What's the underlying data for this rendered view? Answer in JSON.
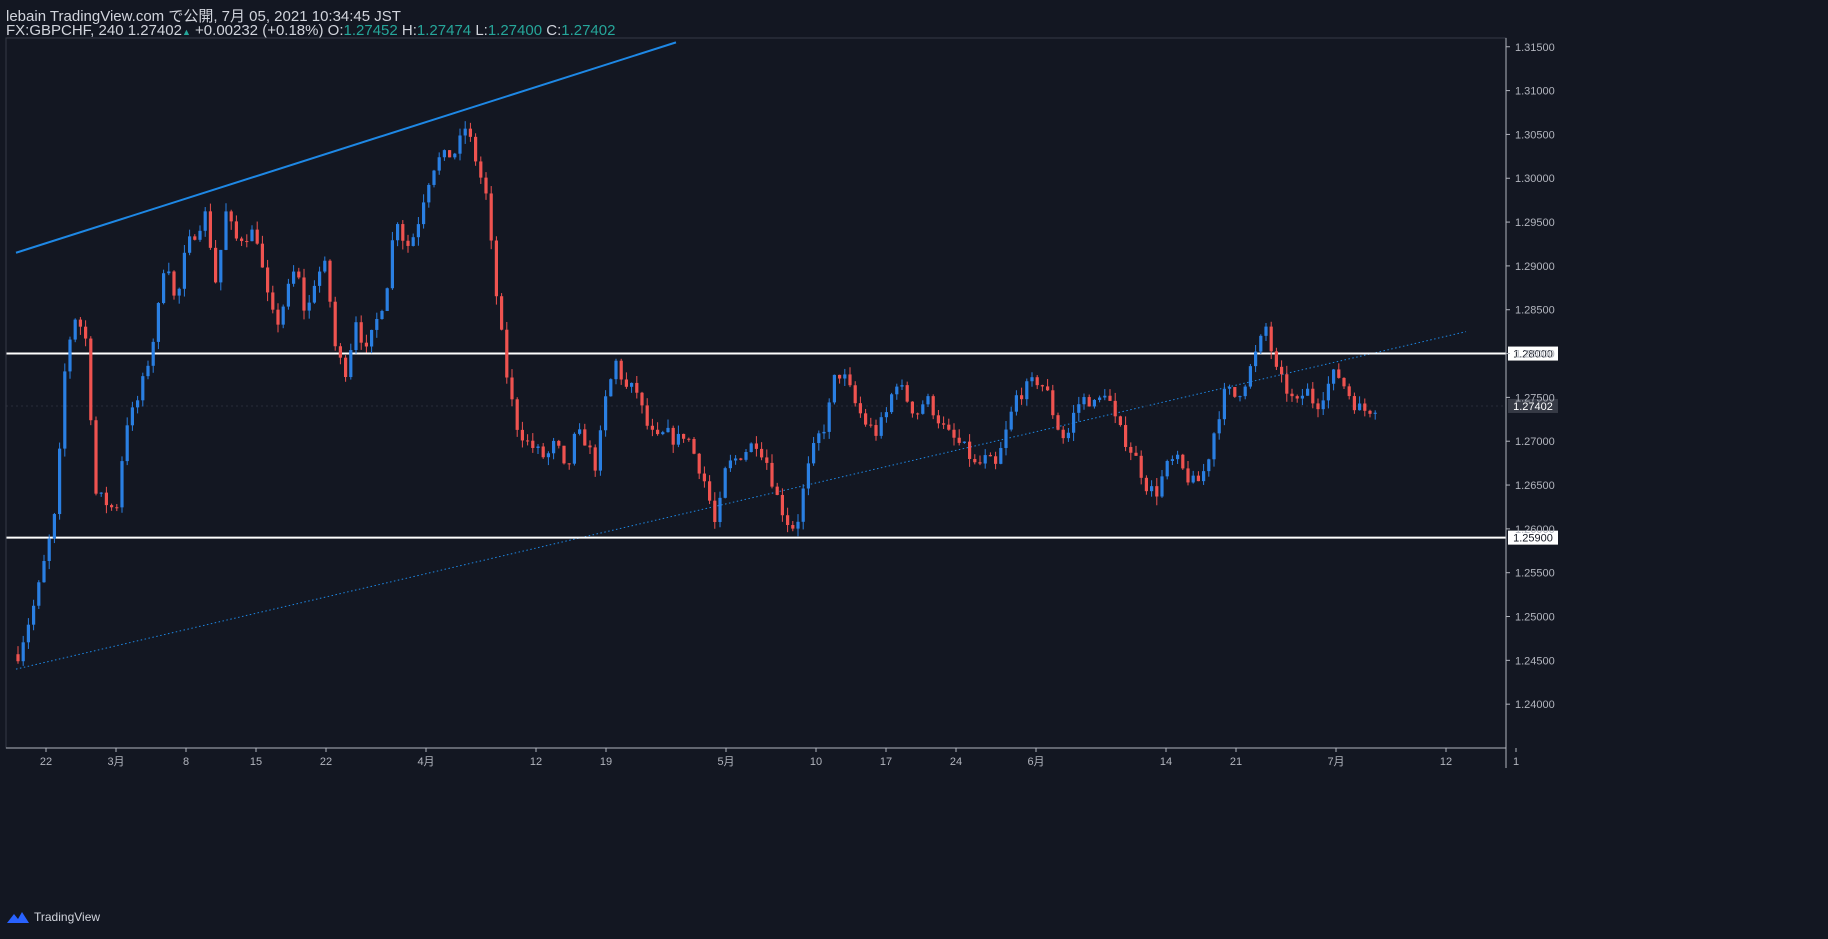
{
  "header": {
    "publisher": "lebain TradingView.com で公開, 7月 05, 2021 10:34:45 JST",
    "symbol": "FX:GBPCHF, 240",
    "last": "1.27402",
    "arrow": "▲",
    "change": "+0.00232 (+0.18%)",
    "o_label": "O:",
    "o": "1.27452",
    "h_label": "H:",
    "h": "1.27474",
    "l_label": "L:",
    "l": "1.27400",
    "c_label": "C:",
    "c": "1.27402"
  },
  "footer": {
    "brand": "TradingView"
  },
  "colors": {
    "background": "#131722",
    "up": "#2a7fe2",
    "down": "#ef5350",
    "trend": "#1e88e5",
    "level": "#ffffff",
    "axis": "#b2b5be"
  },
  "chart_data": {
    "type": "candlestick",
    "symbol": "GBPCHF",
    "timeframe": "240",
    "ylim": [
      1.235,
      1.316
    ],
    "y_ticks": [
      "1.24000",
      "1.24500",
      "1.25000",
      "1.25500",
      "1.26000",
      "1.26500",
      "1.27000",
      "1.27500",
      "1.28000",
      "1.28500",
      "1.29000",
      "1.29500",
      "1.30000",
      "1.30500",
      "1.31000",
      "1.31500"
    ],
    "x_ticks": [
      "22",
      "3月",
      "8",
      "15",
      "22",
      "4月",
      "12",
      "19",
      "5月",
      "10",
      "17",
      "24",
      "6月",
      "14",
      "21",
      "7月",
      "12",
      "1"
    ],
    "horizontal_levels": [
      {
        "value": 1.28,
        "label": "1.28000"
      },
      {
        "value": 1.259,
        "label": "1.25900"
      }
    ],
    "last_price": {
      "value": 1.27402,
      "label": "1.27402"
    },
    "trendlines": [
      {
        "style": "solid",
        "from": [
          "2021-02-19",
          1.2915
        ],
        "to": [
          "2021-04-26",
          1.3155
        ]
      },
      {
        "style": "dotted",
        "from": [
          "2021-02-19",
          1.244
        ],
        "to": [
          "2021-07-14",
          1.2825
        ]
      }
    ],
    "path": [
      [
        "2021-02-19",
        1.245
      ],
      [
        "2021-02-21",
        1.252
      ],
      [
        "2021-02-23",
        1.262
      ],
      [
        "2021-02-24",
        1.28
      ],
      [
        "2021-02-25",
        1.2845
      ],
      [
        "2021-02-26",
        1.2815
      ],
      [
        "2021-02-27",
        1.264
      ],
      [
        "2021-03-01",
        1.262
      ],
      [
        "2021-03-02",
        1.272
      ],
      [
        "2021-03-03",
        1.274
      ],
      [
        "2021-03-04",
        1.278
      ],
      [
        "2021-03-05",
        1.283
      ],
      [
        "2021-03-06",
        1.292
      ],
      [
        "2021-03-07",
        1.285
      ],
      [
        "2021-03-08",
        1.292
      ],
      [
        "2021-03-10",
        1.296
      ],
      [
        "2021-03-11",
        1.288
      ],
      [
        "2021-03-12",
        1.296
      ],
      [
        "2021-03-13",
        1.293
      ],
      [
        "2021-03-15",
        1.294
      ],
      [
        "2021-03-16",
        1.287
      ],
      [
        "2021-03-17",
        1.283
      ],
      [
        "2021-03-19",
        1.29
      ],
      [
        "2021-03-20",
        1.284
      ],
      [
        "2021-03-21",
        1.289
      ],
      [
        "2021-03-22",
        1.29
      ],
      [
        "2021-03-23",
        1.28
      ],
      [
        "2021-03-24",
        1.278
      ],
      [
        "2021-03-25",
        1.284
      ],
      [
        "2021-03-26",
        1.28
      ],
      [
        "2021-03-28",
        1.287
      ],
      [
        "2021-03-29",
        1.296
      ],
      [
        "2021-03-30",
        1.292
      ],
      [
        "2021-03-31",
        1.294
      ],
      [
        "2021-04-01",
        1.299
      ],
      [
        "2021-04-02",
        1.302
      ],
      [
        "2021-04-04",
        1.303
      ],
      [
        "2021-04-05",
        1.306
      ],
      [
        "2021-04-06",
        1.302
      ],
      [
        "2021-04-07",
        1.298
      ],
      [
        "2021-04-08",
        1.287
      ],
      [
        "2021-04-09",
        1.278
      ],
      [
        "2021-04-10",
        1.272
      ],
      [
        "2021-04-11",
        1.27
      ],
      [
        "2021-04-12",
        1.269
      ],
      [
        "2021-04-13",
        1.268
      ],
      [
        "2021-04-14",
        1.27
      ],
      [
        "2021-04-15",
        1.266
      ],
      [
        "2021-04-16",
        1.271
      ],
      [
        "2021-04-17",
        1.27
      ],
      [
        "2021-04-18",
        1.267
      ],
      [
        "2021-04-19",
        1.275
      ],
      [
        "2021-04-20",
        1.279
      ],
      [
        "2021-04-21",
        1.276
      ],
      [
        "2021-04-22",
        1.276
      ],
      [
        "2021-04-23",
        1.272
      ],
      [
        "2021-04-24",
        1.27
      ],
      [
        "2021-04-25",
        1.271
      ],
      [
        "2021-04-26",
        1.27
      ],
      [
        "2021-04-27",
        1.271
      ],
      [
        "2021-04-28",
        1.268
      ],
      [
        "2021-04-29",
        1.265
      ],
      [
        "2021-04-30",
        1.26
      ],
      [
        "2021-05-01",
        1.267
      ],
      [
        "2021-05-02",
        1.268
      ],
      [
        "2021-05-03",
        1.269
      ],
      [
        "2021-05-04",
        1.27
      ],
      [
        "2021-05-05",
        1.268
      ],
      [
        "2021-05-06",
        1.264
      ],
      [
        "2021-05-07",
        1.261
      ],
      [
        "2021-05-08",
        1.26
      ],
      [
        "2021-05-09",
        1.266
      ],
      [
        "2021-05-10",
        1.27
      ],
      [
        "2021-05-11",
        1.272
      ],
      [
        "2021-05-12",
        1.278
      ],
      [
        "2021-05-13",
        1.277
      ],
      [
        "2021-05-14",
        1.274
      ],
      [
        "2021-05-15",
        1.272
      ],
      [
        "2021-05-16",
        1.271
      ],
      [
        "2021-05-17",
        1.273
      ],
      [
        "2021-05-18",
        1.277
      ],
      [
        "2021-05-19",
        1.275
      ],
      [
        "2021-05-20",
        1.273
      ],
      [
        "2021-05-21",
        1.275
      ],
      [
        "2021-05-22",
        1.273
      ],
      [
        "2021-05-23",
        1.271
      ],
      [
        "2021-05-24",
        1.27
      ],
      [
        "2021-05-25",
        1.269
      ],
      [
        "2021-05-26",
        1.267
      ],
      [
        "2021-05-27",
        1.268
      ],
      [
        "2021-05-28",
        1.267
      ],
      [
        "2021-05-29",
        1.271
      ],
      [
        "2021-05-30",
        1.275
      ],
      [
        "2021-06-01",
        1.277
      ],
      [
        "2021-06-02",
        1.276
      ],
      [
        "2021-06-03",
        1.272
      ],
      [
        "2021-06-04",
        1.27
      ],
      [
        "2021-06-05",
        1.274
      ],
      [
        "2021-06-06",
        1.275
      ],
      [
        "2021-06-07",
        1.274
      ],
      [
        "2021-06-08",
        1.276
      ],
      [
        "2021-06-09",
        1.272
      ],
      [
        "2021-06-10",
        1.27
      ],
      [
        "2021-06-11",
        1.268
      ],
      [
        "2021-06-12",
        1.265
      ],
      [
        "2021-06-13",
        1.264
      ],
      [
        "2021-06-14",
        1.267
      ],
      [
        "2021-06-15",
        1.268
      ],
      [
        "2021-06-16",
        1.266
      ],
      [
        "2021-06-17",
        1.265
      ],
      [
        "2021-06-18",
        1.267
      ],
      [
        "2021-06-19",
        1.272
      ],
      [
        "2021-06-20",
        1.276
      ],
      [
        "2021-06-21",
        1.275
      ],
      [
        "2021-06-22",
        1.277
      ],
      [
        "2021-06-23",
        1.28
      ],
      [
        "2021-06-24",
        1.283
      ],
      [
        "2021-06-25",
        1.278
      ],
      [
        "2021-06-26",
        1.276
      ],
      [
        "2021-06-27",
        1.274
      ],
      [
        "2021-06-28",
        1.276
      ],
      [
        "2021-06-29",
        1.274
      ],
      [
        "2021-06-30",
        1.276
      ],
      [
        "2021-07-01",
        1.278
      ],
      [
        "2021-07-02",
        1.276
      ],
      [
        "2021-07-03",
        1.274
      ],
      [
        "2021-07-04",
        1.2735
      ],
      [
        "2021-07-05",
        1.27402
      ]
    ]
  }
}
